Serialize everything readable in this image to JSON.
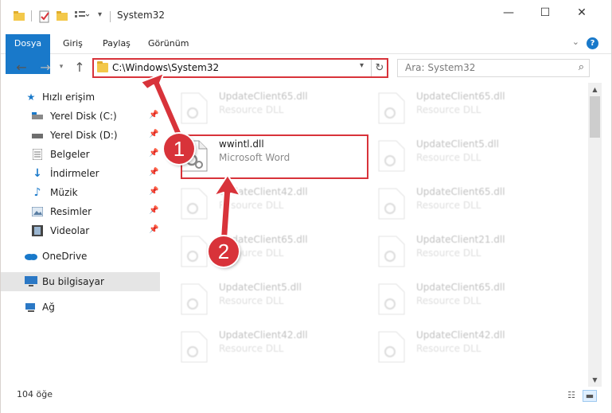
{
  "window": {
    "title": "System32",
    "controls": {
      "minimize": "—",
      "maximize": "☐",
      "close": "✕"
    }
  },
  "ribbon": {
    "tabs": [
      {
        "label": "Dosya",
        "active": true
      },
      {
        "label": "Giriş"
      },
      {
        "label": "Paylaş"
      },
      {
        "label": "Görünüm"
      }
    ],
    "help": "?"
  },
  "address": {
    "path": "C:\\Windows\\System32"
  },
  "search": {
    "placeholder": "Ara: System32"
  },
  "sidebar": {
    "items": [
      {
        "label": "Hızlı erişim",
        "icon": "star-icon"
      },
      {
        "label": "Yerel Disk (C:)",
        "icon": "drive-c-icon",
        "pinned": true
      },
      {
        "label": "Yerel Disk (D:)",
        "icon": "drive-d-icon",
        "pinned": true
      },
      {
        "label": "Belgeler",
        "icon": "documents-icon",
        "pinned": true
      },
      {
        "label": "İndirmeler",
        "icon": "downloads-icon",
        "pinned": true
      },
      {
        "label": "Müzik",
        "icon": "music-icon",
        "pinned": true
      },
      {
        "label": "Resimler",
        "icon": "pictures-icon",
        "pinned": true
      },
      {
        "label": "Videolar",
        "icon": "videos-icon",
        "pinned": true
      },
      {
        "label": "OneDrive",
        "icon": "onedrive-icon"
      },
      {
        "label": "Bu bilgisayar",
        "icon": "this-pc-icon",
        "selected": true
      },
      {
        "label": "Ağ",
        "icon": "network-icon"
      }
    ]
  },
  "files": [
    {
      "name": "UpdateClient65.dll",
      "type": "Resource DLL"
    },
    {
      "name": "UpdateClient65.dll",
      "type": "Resource DLL"
    },
    {
      "name": "wwintl.dll",
      "type": "Microsoft Word",
      "highlighted": true
    },
    {
      "name": "UpdateClient5.dll",
      "type": "Resource DLL"
    },
    {
      "name": "UpdateClient42.dll",
      "type": "Resource DLL"
    },
    {
      "name": "UpdateClient65.dll",
      "type": "Resource DLL"
    },
    {
      "name": "UpdateClient65.dll",
      "type": "Resource DLL"
    },
    {
      "name": "UpdateClient21.dll",
      "type": "Resource DLL"
    },
    {
      "name": "UpdateClient5.dll",
      "type": "Resource DLL"
    },
    {
      "name": "UpdateClient65.dll",
      "type": "Resource DLL"
    },
    {
      "name": "UpdateClient42.dll",
      "type": "Resource DLL"
    },
    {
      "name": "UpdateClient42.dll",
      "type": "Resource DLL"
    }
  ],
  "status": {
    "item_count": "104 öğe"
  },
  "annotations": [
    {
      "number": "1",
      "target": "address-bar"
    },
    {
      "number": "2",
      "target": "wwintl.dll"
    }
  ],
  "colors": {
    "accent": "#1979ca",
    "annotation": "#d8333a",
    "selection": "#cce8ff"
  }
}
